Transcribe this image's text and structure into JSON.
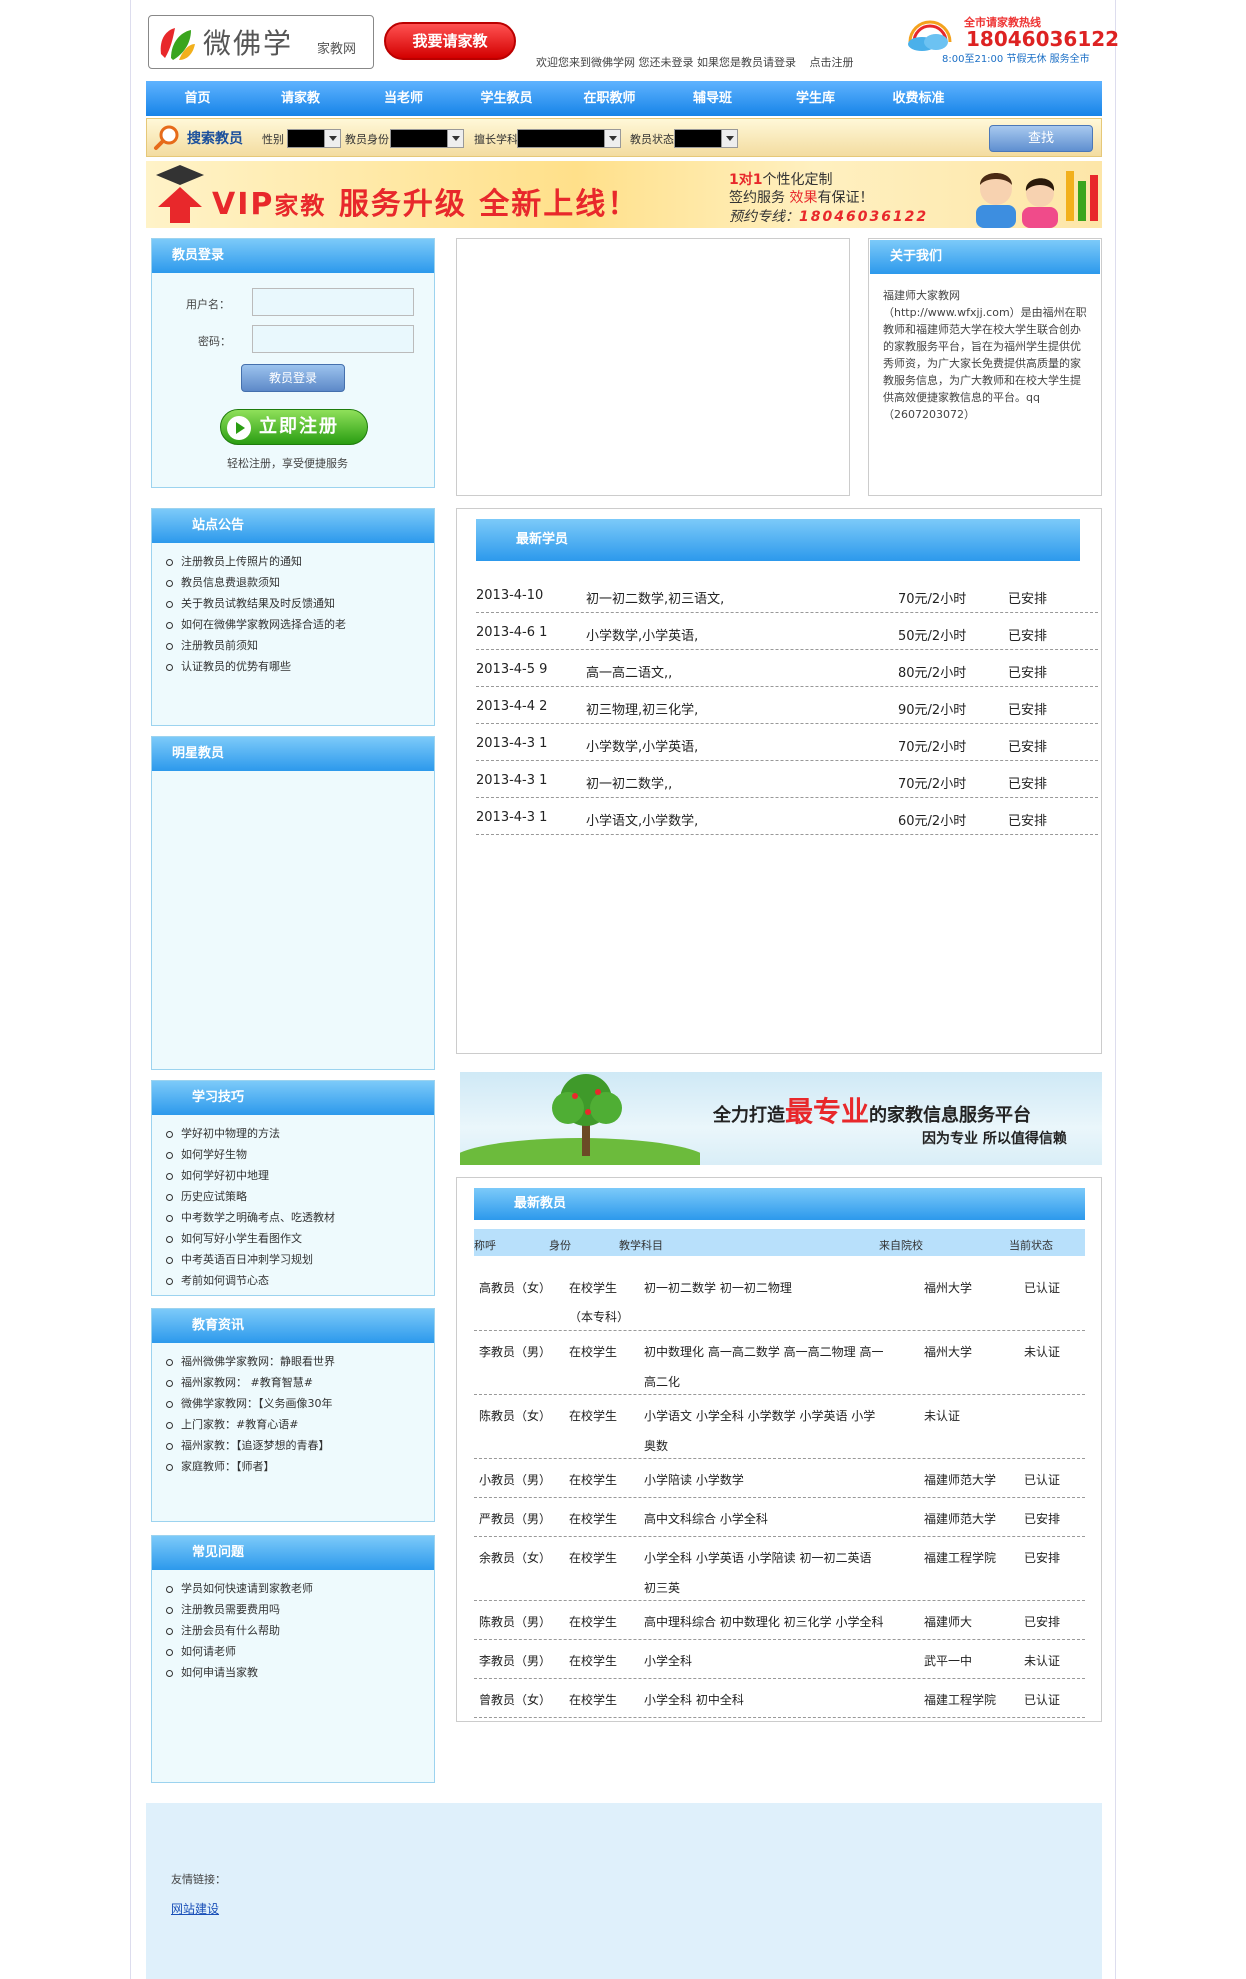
{
  "header": {
    "logo_name": "微佛学",
    "logo_sub": "家教网",
    "hire_button": "我要请家教",
    "welcome_text": "欢迎您来到微佛学网 您还未登录 如果您是教员请登录",
    "register_link": "点击注册",
    "hotline_title": "全市请家教热线",
    "hotline_number": "18046036122",
    "hotline_hours": "8:00至21:00 节假无休 服务全市"
  },
  "nav": [
    "首页",
    "请家教",
    "当老师",
    "学生教员",
    "在职教师",
    "辅导班",
    "学生库",
    "收费标准"
  ],
  "search": {
    "title": "搜索教员",
    "gender_label": "性别",
    "identity_label": "教员身份",
    "subject_label": "擅长学科",
    "status_label": "教员状态",
    "button": "查找"
  },
  "vip_banner": {
    "headline_a": "VIP",
    "headline_b": "家教",
    "headline_c": " 服务升级 ",
    "headline_d": "全新上线！",
    "line1_a": "1对1",
    "line1_b": "个性化定制",
    "line2_a": "签约服务 ",
    "line2_b": "效果",
    "line2_c": "有保证！",
    "line3_a": "预约专线：",
    "line3_b": "18046036122"
  },
  "login": {
    "title": "教员登录",
    "username_label": "用户名：",
    "password_label": "密码：",
    "login_button": "教员登录",
    "register_button": "立即注册",
    "register_tip": "轻松注册，享受便捷服务"
  },
  "about": {
    "title": "关于我们",
    "text": "福建师大家教网（http://www.wfxjj.com）是由福州在职教师和福建师范大学在校大学生联合创办的家教服务平台，旨在为福州学生提供优秀师资，为广大家长免费提供高质量的家教服务信息，为广大教师和在校大学生提供高效便捷家教信息的平台。qq（2607203072）"
  },
  "notice": {
    "title": "站点公告",
    "items": [
      "注册教员上传照片的通知",
      "教员信息费退款须知",
      "关于教员试教结果及时反馈通知",
      "如何在微佛学家教网选择合适的老",
      "注册教员前须知",
      "认证教员的优势有哪些"
    ]
  },
  "star": {
    "title": "明星教员"
  },
  "study": {
    "title": "学习技巧",
    "items": [
      "学好初中物理的方法",
      "如何学好生物",
      "如何学好初中地理",
      "历史应试策略",
      "中考数学之明确考点、吃透教材",
      "如何写好小学生看图作文",
      "中考英语百日冲刺学习规划",
      "考前如何调节心态"
    ]
  },
  "news": {
    "title": "教育资讯",
    "items": [
      "福州微佛学家教网：静眼看世界",
      "福州家教网： #教育智慧#",
      "微佛学家教网：【义务画像30年",
      "上门家教：#教育心语#",
      "福州家教：【追逐梦想的青春】",
      "家庭教师：【师者】"
    ]
  },
  "faq": {
    "title": "常见问题",
    "items": [
      "学员如何快速请到家教老师",
      "注册教员需要费用吗",
      "注册会员有什么帮助",
      "如何请老师",
      "如何申请当家教"
    ]
  },
  "students": {
    "title": "最新学员",
    "rows": [
      {
        "date": "2013-4-10",
        "subject": "初一初二数学,初三语文,",
        "fee": "70元/2小时",
        "status": "已安排"
      },
      {
        "date": "2013-4-6 1",
        "subject": "小学数学,小学英语,",
        "fee": "50元/2小时",
        "status": "已安排"
      },
      {
        "date": "2013-4-5 9",
        "subject": "高一高二语文,,",
        "fee": "80元/2小时",
        "status": "已安排"
      },
      {
        "date": "2013-4-4 2",
        "subject": "初三物理,初三化学,",
        "fee": "90元/2小时",
        "status": "已安排"
      },
      {
        "date": "2013-4-3 1",
        "subject": "小学数学,小学英语,",
        "fee": "70元/2小时",
        "status": "已安排"
      },
      {
        "date": "2013-4-3 1",
        "subject": "初一初二数学,,",
        "fee": "70元/2小时",
        "status": "已安排"
      },
      {
        "date": "2013-4-3 1",
        "subject": "小学语文,小学数学,",
        "fee": "60元/2小时",
        "status": "已安排"
      }
    ]
  },
  "tree_banner": {
    "line1_a": "全力打造",
    "line1_b": "最专业",
    "line1_c": "的家教信息服务平台",
    "line2": "因为专业 所以值得信赖"
  },
  "teachers": {
    "title": "最新教员",
    "headers": [
      "称呼",
      "身份",
      "教学科目",
      "来自院校",
      "当前状态"
    ],
    "rows": [
      {
        "name": "高教员（女）",
        "identity": "在校学生",
        "subject": "初一初二数学 初一初二物理",
        "subject2": "",
        "school": "福州大学",
        "status": "已认证",
        "extra": "（本专科）"
      },
      {
        "name": "李教员（男）",
        "identity": "在校学生",
        "subject": "初中数理化 高一高二数学 高一高二物理 高一",
        "subject2": "高二化",
        "school": "福州大学",
        "status": "未认证",
        "extra": ""
      },
      {
        "name": "陈教员（女）",
        "identity": "在校学生",
        "subject": "小学语文 小学全科 小学数学 小学英语 小学",
        "subject2": "奥数",
        "school": "",
        "status": "未认证",
        "extra": ""
      },
      {
        "name": "小教员（男）",
        "identity": "在校学生",
        "subject": "小学陪读 小学数学",
        "subject2": "",
        "school": "福建师范大学",
        "status": "已认证",
        "extra": ""
      },
      {
        "name": "严教员（男）",
        "identity": "在校学生",
        "subject": "高中文科综合 小学全科",
        "subject2": "",
        "school": "福建师范大学",
        "status": "已安排",
        "extra": ""
      },
      {
        "name": "余教员（女）",
        "identity": "在校学生",
        "subject": "小学全科 小学英语 小学陪读 初一初二英语",
        "subject2": "初三英",
        "school": "福建工程学院",
        "status": "已安排",
        "extra": ""
      },
      {
        "name": "陈教员（男）",
        "identity": "在校学生",
        "subject": "高中理科综合 初中数理化 初三化学 小学全科",
        "subject2": "",
        "school": "福建师大",
        "status": "已安排",
        "extra": ""
      },
      {
        "name": "李教员（男）",
        "identity": "在校学生",
        "subject": "小学全科",
        "subject2": "",
        "school": "武平一中",
        "status": "未认证",
        "extra": ""
      },
      {
        "name": "曾教员（女）",
        "identity": "在校学生",
        "subject": "小学全科 初中全科",
        "subject2": "",
        "school": "福建工程学院",
        "status": "已认证",
        "extra": ""
      }
    ]
  },
  "footer": {
    "links_label": "友情链接：",
    "link": "网站建设"
  }
}
